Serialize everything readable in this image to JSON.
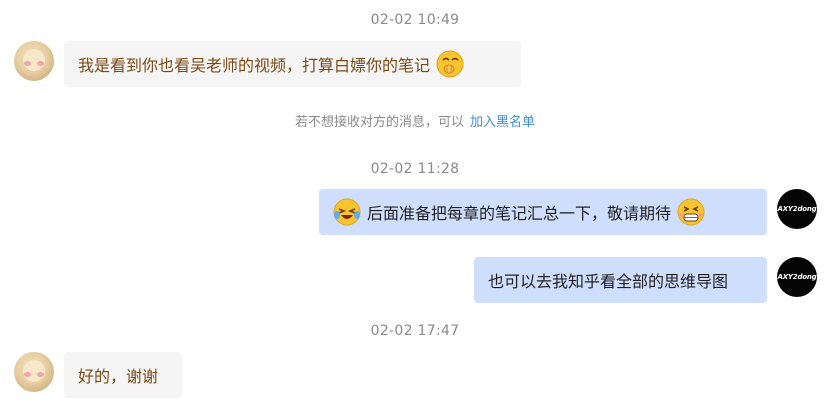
{
  "chat": {
    "timestamps": [
      "02-02 10:49",
      "02-02 11:28",
      "02-02 17:47"
    ],
    "notice": {
      "text": "若不想接收对方的消息，可以",
      "link": "加入黑名单"
    },
    "my_avatar_text": "AXY2dong",
    "messages": [
      {
        "from": "them",
        "text": "我是看到你也看吴老师的视频，打算白嫖你的笔记",
        "emoji": "shush-emoji"
      },
      {
        "from": "me",
        "text": "后面准备把每章的笔记汇总一下，敬请期待",
        "emoji_before": "laughing-crying-emoji",
        "emoji_after": "grinning-emoji"
      },
      {
        "from": "me",
        "text": "也可以去我知乎看全部的思维导图"
      },
      {
        "from": "them",
        "text": "好的，谢谢"
      }
    ]
  }
}
